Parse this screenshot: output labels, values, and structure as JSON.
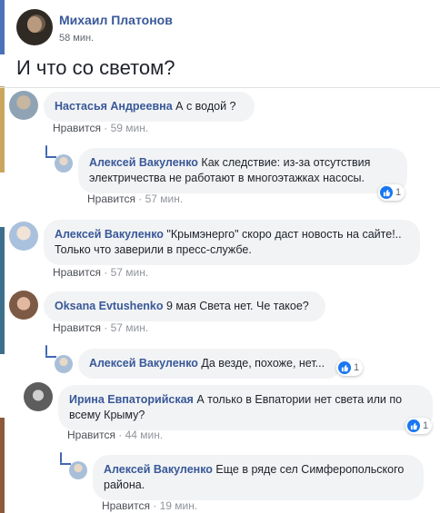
{
  "colors": {
    "author_blue": "#385898",
    "bubble_bg": "#f2f3f5",
    "meta_grey": "#90949c",
    "like_blue": "#1877f2"
  },
  "post": {
    "author": "Михаил Платонов",
    "time": "58 мин.",
    "text": "И что со светом?"
  },
  "comments": [
    {
      "author": "Настасья Андреевна",
      "text": "А с водой ?",
      "like_label": "Нравится",
      "sep": " · ",
      "time": "59 мин."
    },
    {
      "author": "Алексей Вакуленко",
      "text": "Как следствие: из-за отсутствия электричества не работают в многоэтажках насосы.",
      "like_label": "Нравится",
      "sep": " · ",
      "time": "57 мин.",
      "reaction_count": "1"
    },
    {
      "author": "Алексей Вакуленко",
      "text": "\"Крымэнерго\" скоро даст новость на сайте!.. Только что заверили в пресс-службе.",
      "like_label": "Нравится",
      "sep": " · ",
      "time": "57 мин."
    },
    {
      "author": "Oksana Evtushenko",
      "text": "9 мая Света нет. Че такое?",
      "like_label": "Нравится",
      "sep": " · ",
      "time": "57 мин."
    },
    {
      "author": "Алексей Вакуленко",
      "text": "Да везде, похоже, нет...",
      "reaction_count": "1"
    },
    {
      "author": "Ирина Евпаторийская",
      "text": "А только в Евпатории нет света или по всему Крыму?",
      "like_label": "Нравится",
      "sep": " · ",
      "time": "44 мин.",
      "reaction_count": "1"
    },
    {
      "author": "Алексей Вакуленко",
      "text": "Еще в ряде сел Симферопольского района.",
      "like_label": "Нравится",
      "sep": " · ",
      "time": "19 мин."
    }
  ]
}
